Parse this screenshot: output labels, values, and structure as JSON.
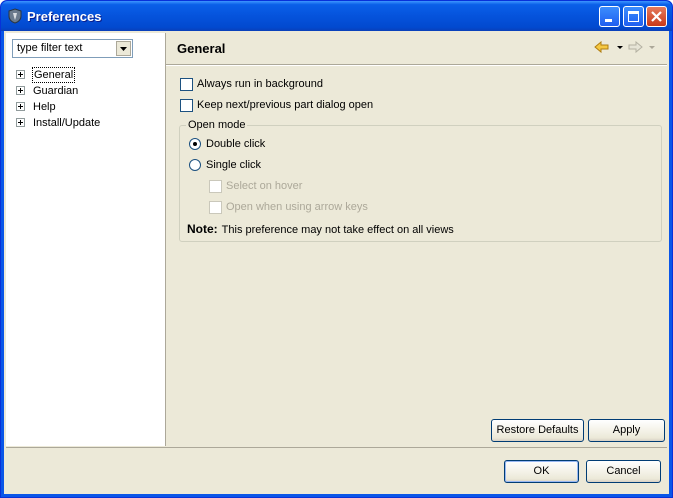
{
  "window": {
    "title": "Preferences"
  },
  "filter": {
    "placeholder": "type filter text"
  },
  "tree": {
    "items": [
      {
        "label": "General"
      },
      {
        "label": "Guardian"
      },
      {
        "label": "Help"
      },
      {
        "label": "Install/Update"
      }
    ]
  },
  "page": {
    "title": "General",
    "options": {
      "always_run_background": {
        "label": "Always run in background",
        "checked": false
      },
      "keep_dialog_open": {
        "label": "Keep next/previous part dialog open",
        "checked": false
      }
    },
    "open_mode": {
      "label": "Open mode",
      "double_click": {
        "label": "Double click",
        "selected": true
      },
      "single_click": {
        "label": "Single click",
        "selected": false
      },
      "select_on_hover": {
        "label": "Select on hover",
        "enabled": false
      },
      "open_arrow_keys": {
        "label": "Open when using arrow keys",
        "enabled": false
      }
    },
    "note": {
      "prefix": "Note:",
      "text": "This preference may not take effect on all views"
    },
    "restore_defaults_label": "Restore Defaults",
    "apply_label": "Apply"
  },
  "footer": {
    "ok_label": "OK",
    "cancel_label": "Cancel"
  },
  "colors": {
    "titlebar": "#0553dc",
    "client_bg": "#ece9d8",
    "nav_arrow": "#e8a81c"
  }
}
